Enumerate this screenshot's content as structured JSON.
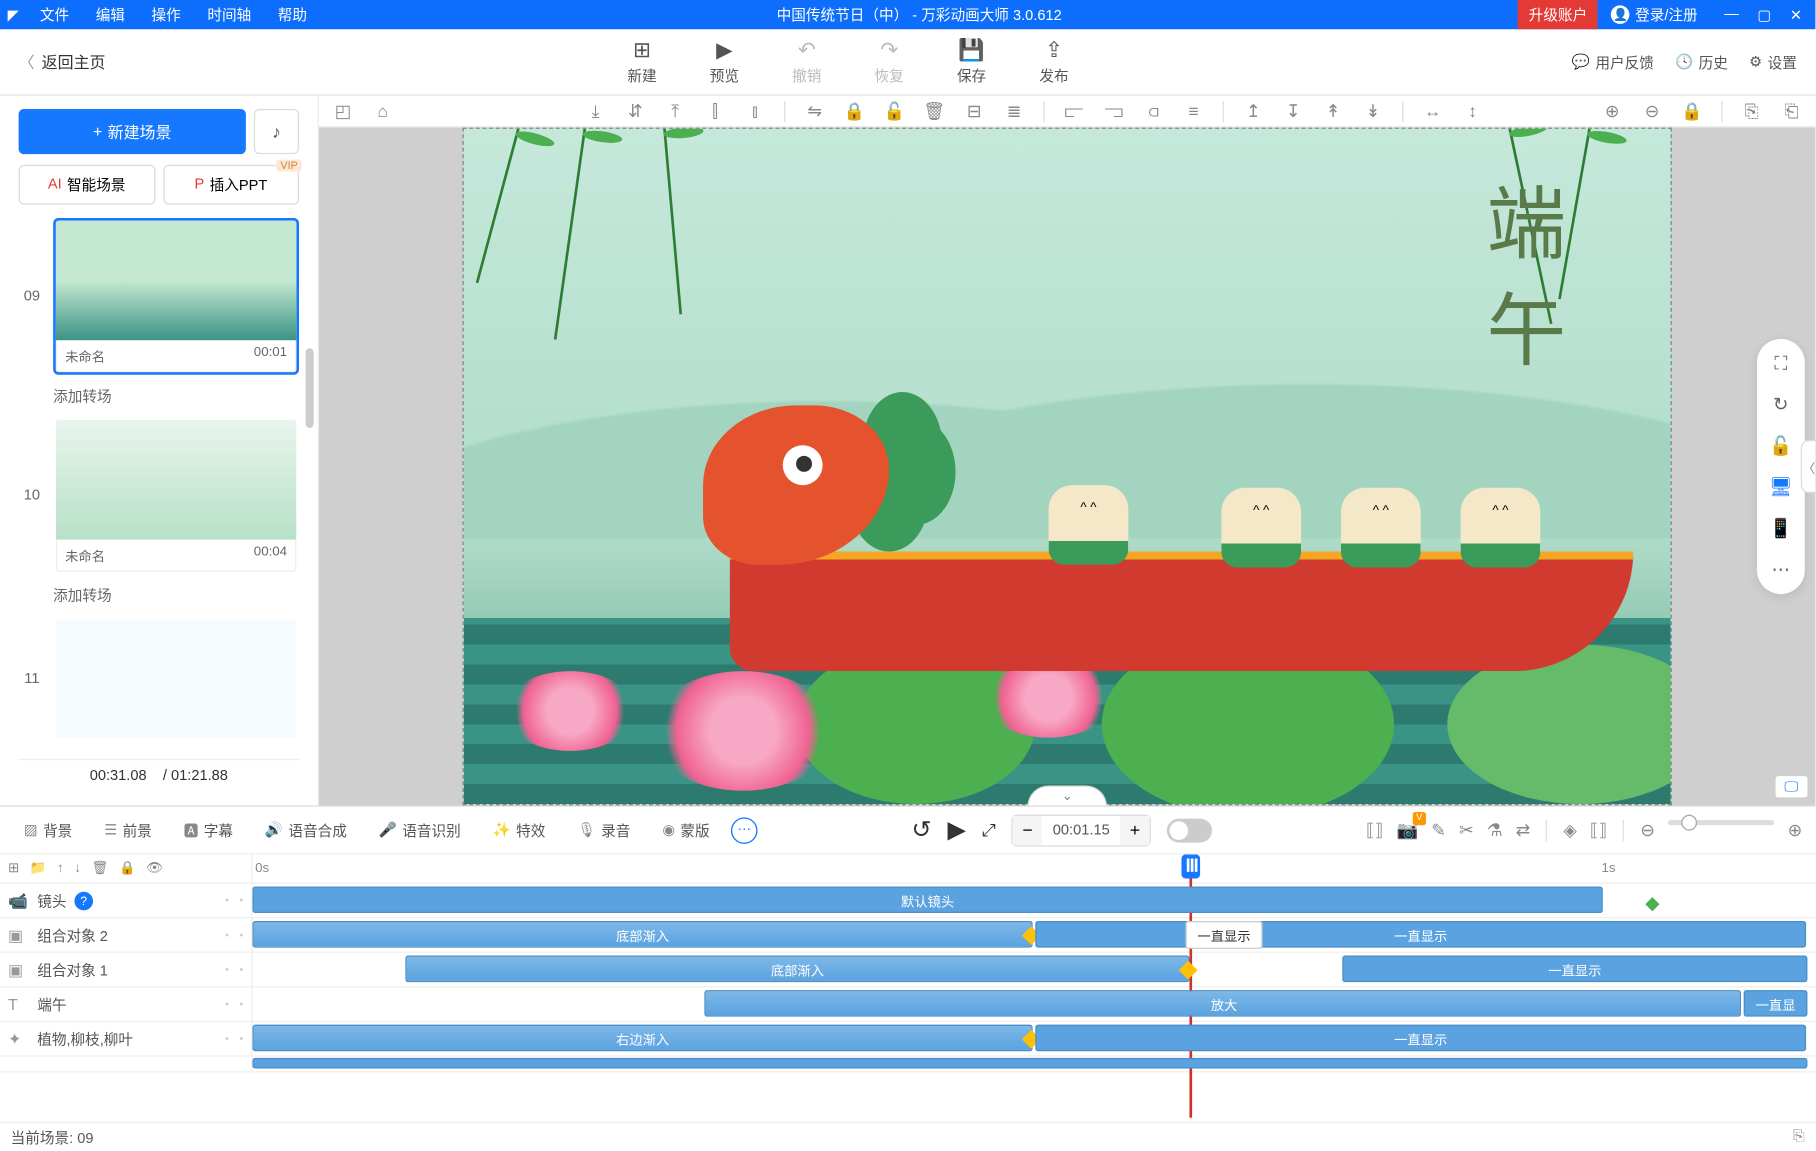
{
  "titlebar": {
    "menus": [
      "文件",
      "编辑",
      "操作",
      "时间轴",
      "帮助"
    ],
    "title": "中国传统节日（中） - 万彩动画大师 3.0.612",
    "upgrade": "升级账户",
    "login": "登录/注册"
  },
  "toolbar": {
    "back": "返回主页",
    "items": {
      "new": "新建",
      "preview": "预览",
      "undo": "撤销",
      "redo": "恢复",
      "save": "保存",
      "publish": "发布"
    },
    "right": {
      "feedback": "用户反馈",
      "history": "历史",
      "settings": "设置"
    }
  },
  "sidebar": {
    "new_scene": "新建场景",
    "smart_scene": "智能场景",
    "insert_ppt": "插入PPT",
    "vip": "VIP",
    "scenes": [
      {
        "num": "09",
        "name": "未命名",
        "time": "00:01",
        "active": true
      },
      {
        "num": "10",
        "name": "未命名",
        "time": "00:04",
        "active": false
      },
      {
        "num": "11",
        "name": "",
        "time": "",
        "active": false
      }
    ],
    "add_transition": "添加转场",
    "time_current": "00:31.08",
    "time_total": "/ 01:21.88"
  },
  "canvas": {
    "title_text": "端午",
    "label": "默认镜头"
  },
  "timeline": {
    "tabs": {
      "bg": "背景",
      "fg": "前景",
      "subtitle": "字幕",
      "tts": "语音合成",
      "asr": "语音识别",
      "fx": "特效",
      "record": "录音",
      "mask": "蒙版"
    },
    "time": "00:01.15",
    "ruler": {
      "start": "0s",
      "end": "1s"
    },
    "tracks": [
      {
        "icon": "camera",
        "name": "镜头",
        "help": true
      },
      {
        "icon": "group",
        "name": "组合对象 2"
      },
      {
        "icon": "group",
        "name": "组合对象 1"
      },
      {
        "icon": "text",
        "name": "端午"
      },
      {
        "icon": "shape",
        "name": "植物,柳枝,柳叶"
      }
    ],
    "clips": {
      "default_shot": "默认镜头",
      "bottom_in": "底部渐入",
      "right_in": "右边渐入",
      "always_show": "一直显示",
      "zoom": "放大",
      "always_show2": "一直显"
    },
    "tooltip": "一直显示",
    "footer": "当前场景: 09"
  }
}
